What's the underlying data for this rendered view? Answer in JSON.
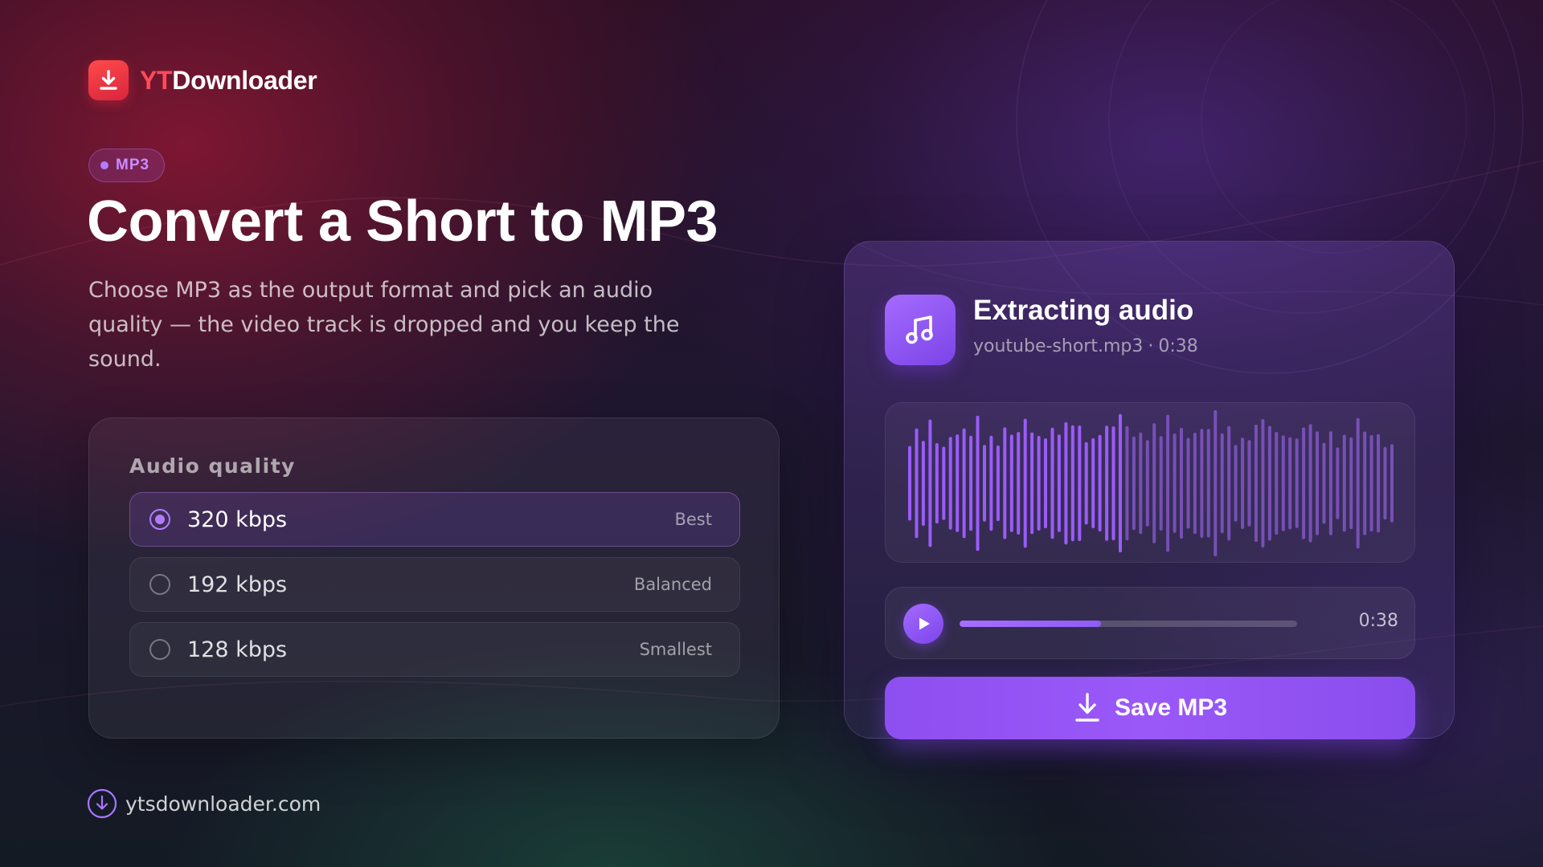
{
  "brand": {
    "name_part1": "YT",
    "name_part2": "Downloader",
    "icon": "download-arrow-icon",
    "color_part1": "#ff4a58",
    "badge_color": "#e8313f"
  },
  "format_pill": {
    "label": "MP3",
    "icon": "dot-icon"
  },
  "headline": "Convert a Short to MP3",
  "subtitle": "Choose MP3 as the output format and pick an audio quality — the video track is dropped and you keep the sound.",
  "quality": {
    "label": "Audio quality",
    "options": [
      {
        "label": "320 kbps",
        "tag": "Best",
        "selected": true
      },
      {
        "label": "192 kbps",
        "tag": "Balanced",
        "selected": false
      },
      {
        "label": "128 kbps",
        "tag": "Smallest",
        "selected": false
      }
    ]
  },
  "footer": {
    "url": "ytsdownloader.com",
    "icon": "download-circle-icon"
  },
  "player": {
    "icon": "music-note-icon",
    "title": "Extracting audio",
    "filename": "youtube-short.mp3",
    "separator": "·",
    "duration": "0:38",
    "play_icon": "play-icon",
    "progress_fraction": 0.42,
    "time": "0:38",
    "save_label": "Save MP3",
    "save_icon": "download-icon",
    "accent_color": "#9b5cf6"
  }
}
